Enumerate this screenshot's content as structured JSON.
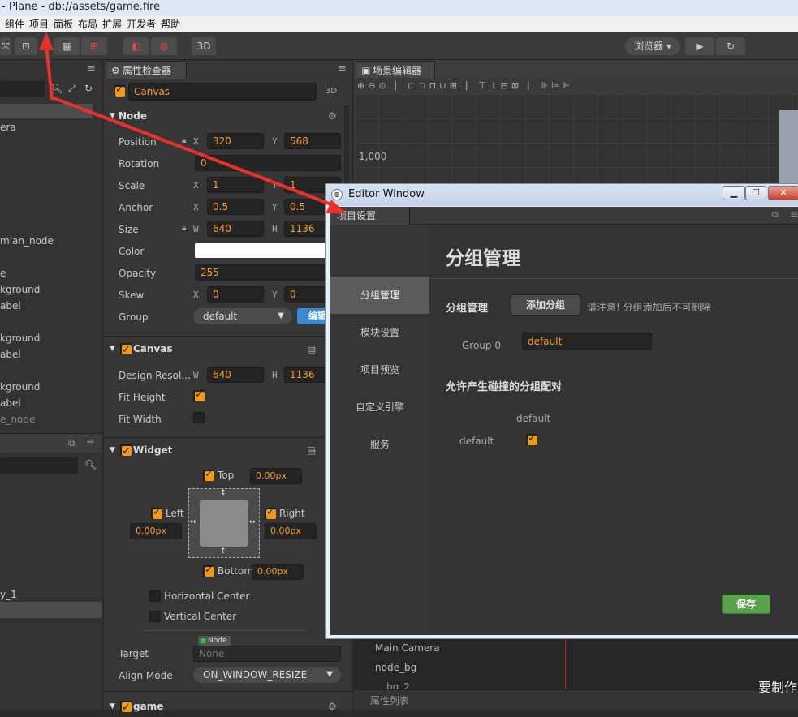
{
  "window": {
    "title": "- Plane - db://assets/game.fire"
  },
  "menu": [
    "组件",
    "项目",
    "面板",
    "布局",
    "扩展",
    "开发者",
    "帮助"
  ],
  "toolbar": {
    "btn_3d": "3D",
    "preview": "浏览器 ▾"
  },
  "panels": {
    "inspector": "属性检查器",
    "scene": "场景编辑器"
  },
  "hierarchy": {
    "items": [
      "era",
      "",
      "",
      "",
      "mian_node",
      "",
      "e",
      "kground",
      "abel",
      "",
      "kground",
      "abel",
      "",
      "kground",
      "abel",
      "e_node"
    ],
    "bottom_items": [
      "y_1"
    ]
  },
  "inspector": {
    "node_name": "Canvas",
    "badge_3d": "3D",
    "sections": {
      "node": "Node",
      "canvas": "Canvas",
      "widget": "Widget",
      "game": "game"
    },
    "props": {
      "position": "Position",
      "rotation": "Rotation",
      "scale": "Scale",
      "anchor": "Anchor",
      "size": "Size",
      "color": "Color",
      "opacity": "Opacity",
      "skew": "Skew",
      "group": "Group"
    },
    "axes": {
      "x": "X",
      "y": "Y",
      "w": "W",
      "h": "H"
    },
    "values": {
      "pos_x": "320",
      "pos_y": "568",
      "rotation": "0",
      "scale_x": "1",
      "scale_y": "1",
      "anchor_x": "0.5",
      "anchor_y": "0.5",
      "size_w": "640",
      "size_h": "1136",
      "opacity": "255",
      "skew_x": "0",
      "skew_y": "0",
      "group": "default",
      "edit_btn": "编辑"
    },
    "canvas": {
      "design": "Design Resol...",
      "fit_height": "Fit Height",
      "fit_width": "Fit Width",
      "w": "640",
      "h": "1136",
      "fit_height_on": true,
      "fit_width_on": false
    },
    "widget": {
      "top": "Top",
      "left": "Left",
      "right": "Right",
      "bottom": "Bottom",
      "px": "0.00px",
      "hcenter": "Horizontal Center",
      "vcenter": "Vertical Center",
      "target": "Target",
      "target_badge": "Node",
      "target_val": "None",
      "align": "Align Mode",
      "align_val": "ON_WINDOW_RESIZE"
    }
  },
  "scene": {
    "ruler_label": "1,000",
    "tree": [
      "Main Camera",
      "node_bg",
      "bg_2"
    ],
    "props_list": "属性列表",
    "overlay_text": "要制作"
  },
  "editor_window": {
    "title": "Editor Window",
    "tab": "项目设置",
    "nav": [
      "分组管理",
      "模块设置",
      "项目预览",
      "自定义引擎",
      "服务"
    ],
    "heading": "分组管理",
    "group_label": "分组管理",
    "add_btn": "添加分组",
    "add_note": "请注意! 分组添加后不可删除",
    "group0": "Group 0",
    "group0_val": "default",
    "collision_title": "允许产生碰撞的分组配对",
    "col_header": "default",
    "row_header": "default",
    "save": "保存"
  }
}
